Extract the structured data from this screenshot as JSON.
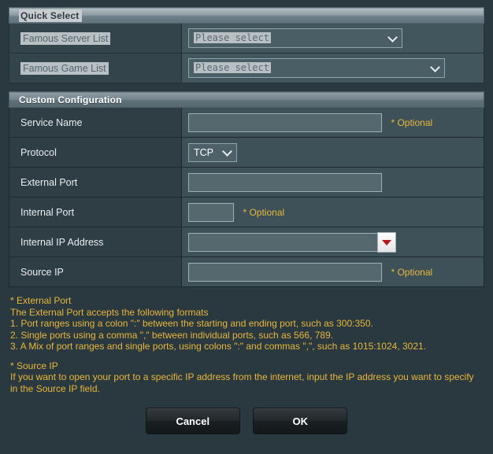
{
  "quick_select": {
    "title": "Quick Select",
    "rows": [
      {
        "label": "Famous Server List",
        "value": "Please select",
        "control": "select"
      },
      {
        "label": "Famous Game List",
        "value": "Please select",
        "control": "select"
      }
    ]
  },
  "custom_configuration": {
    "title": "Custom Configuration",
    "rows": [
      {
        "label": "Service Name",
        "value": "",
        "optional": "* Optional"
      },
      {
        "label": "Protocol",
        "value": "TCP",
        "optional": ""
      },
      {
        "label": "External Port",
        "value": "",
        "optional": ""
      },
      {
        "label": "Internal Port",
        "value": "",
        "optional": "* Optional"
      },
      {
        "label": "Internal IP Address",
        "value": "",
        "optional": ""
      },
      {
        "label": "Source IP",
        "value": "",
        "optional": "* Optional"
      }
    ]
  },
  "help": {
    "external_port_title": "* External Port",
    "external_port_intro": "The External Port accepts the following formats",
    "external_port_1": "1. Port ranges using a colon \":\" between the starting and ending port, such as 300:350.",
    "external_port_2": "2. Single ports using a comma \",\" between individual ports, such as 566, 789.",
    "external_port_3": "3. A Mix of port ranges and single ports, using colons \":\" and commas \",\", such as 1015:1024, 3021.",
    "source_ip_title": "* Source IP",
    "source_ip_line1": "If you want to open your port to a specific IP address from the internet, input the IP address you want to specify",
    "source_ip_line2": "in the Source IP field."
  },
  "buttons": {
    "cancel": "Cancel",
    "ok": "OK"
  },
  "colors": {
    "page_background": "#2a383f",
    "optional_text": "#e8b73c",
    "help_text": "#e8b73c",
    "ip_arrow": "#b51818"
  }
}
